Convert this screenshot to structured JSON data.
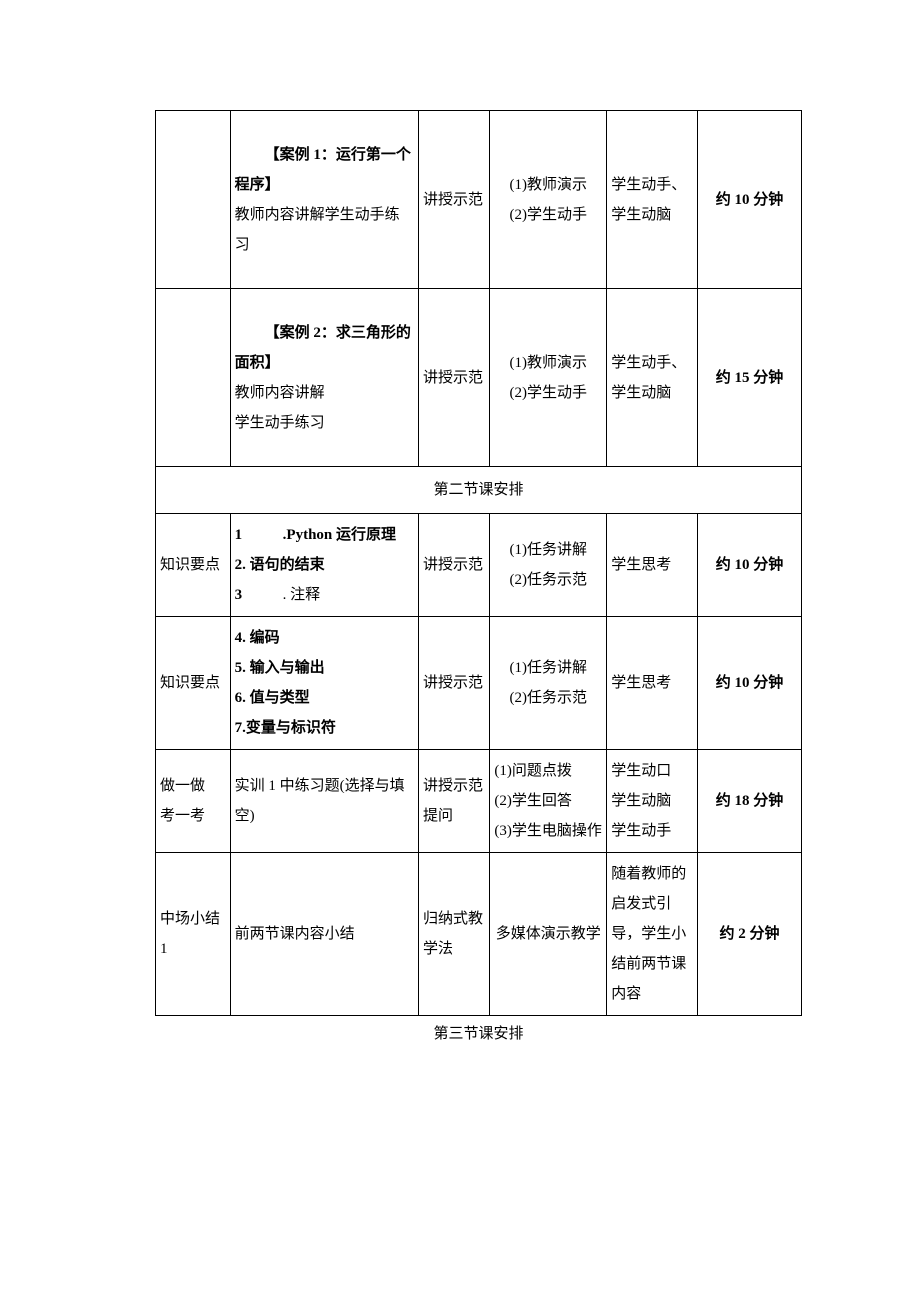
{
  "rows": [
    {
      "c1": "",
      "c2_title": "【案例 1：运行第一个程序】",
      "c2_body": "教师内容讲解学生动手练习",
      "c3": "讲授示范",
      "c4": "(1)教师演示\n(2)学生动手",
      "c5": "学生动手、学生动脑",
      "c6": "约 10 分钟"
    },
    {
      "c1": "",
      "c2_title": "【案例 2：求三角形的面积】",
      "c2_body": "教师内容讲解\n学生动手练习",
      "c3": "讲授示范",
      "c4": "(1)教师演示\n(2)学生动手",
      "c5": "学生动手、学生动脑",
      "c6": "约 15 分钟"
    }
  ],
  "section2_header": "第二节课安排",
  "section2_rows": [
    {
      "c1": "知识要点",
      "c2_items": [
        "1",
        ".Python 运行原理",
        "2. 语句的结束",
        "3",
        ". 注释"
      ],
      "c3": "讲授示范",
      "c4": "(1)任务讲解\n(2)任务示范",
      "c5": "学生思考",
      "c6": "约 10 分钟"
    },
    {
      "c1": "知识要点",
      "c2_items_plain": [
        "4. 编码",
        "5. 输入与输出",
        "6. 值与类型",
        "7.变量与标识符"
      ],
      "c3": "讲授示范",
      "c4": "(1)任务讲解\n(2)任务示范",
      "c5": "学生思考",
      "c6": "约 10 分钟"
    },
    {
      "c1": "做一做\n考一考",
      "c2_plain": "实训 1 中练习题(选择与填空)",
      "c3": "讲授示范提问",
      "c4": "(1)问题点拨\n(2)学生回答\n(3)学生电脑操作",
      "c5": "学生动口\n学生动脑\n学生动手",
      "c6": "约 18 分钟"
    },
    {
      "c1": "中场小结 1",
      "c2_plain": "前两节课内容小结",
      "c3": "归纳式教学法",
      "c4": "多媒体演示教学",
      "c5": "随着教师的启发式引导，学生小结前两节课内容",
      "c6": "约 2 分钟"
    }
  ],
  "footer": "第三节课安排"
}
